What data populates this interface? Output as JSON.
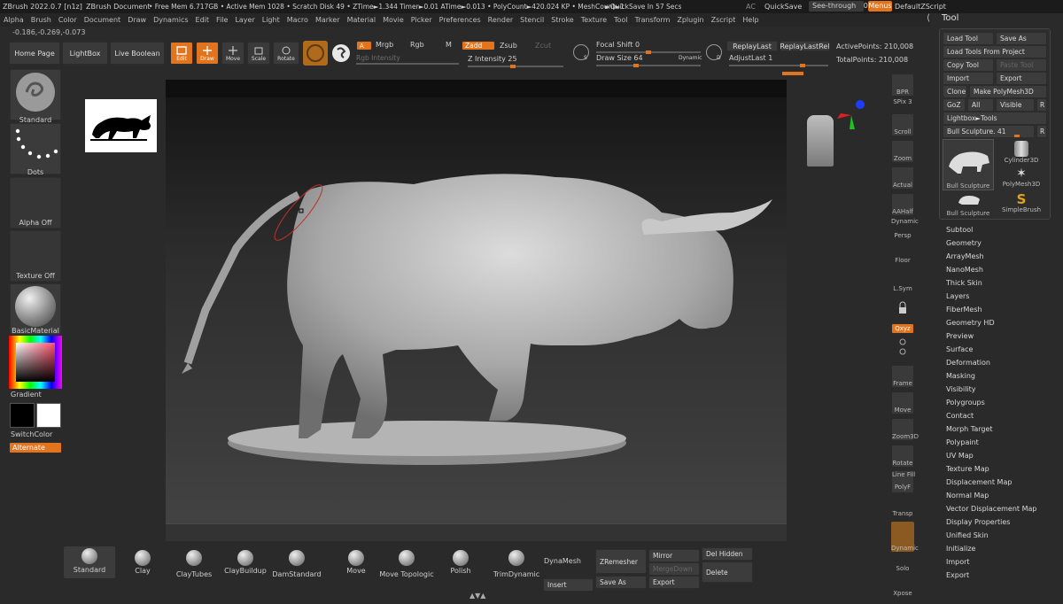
{
  "topbar": {
    "app_title": "ZBrush 2022.0.7 [n1z]",
    "document": "ZBrush Document",
    "stats": "• Free Mem 6.717GB • Active Mem 1028 • Scratch Disk 49 • ZTime►1.344 Timer►0.01 ATime►0.013 • PolyCount►420.024 KP • MeshCount►1",
    "quicksave_timer": "►QuickSave In 57 Secs",
    "ac": "AC",
    "quicksave": "QuickSave",
    "seethrough": "See-through",
    "seethrough_value": "0",
    "menus": "Menus",
    "script": "DefaultZScript"
  },
  "menubar": [
    "Alpha",
    "Brush",
    "Color",
    "Document",
    "Draw",
    "Dynamics",
    "Edit",
    "File",
    "Layer",
    "Light",
    "Macro",
    "Marker",
    "Material",
    "Movie",
    "Picker",
    "Preferences",
    "Render",
    "Stencil",
    "Stroke",
    "Texture",
    "Tool",
    "Transform",
    "Zplugin",
    "Zscript",
    "Help"
  ],
  "coords": "-0.186,-0.269,-0.073",
  "toolbar": {
    "home_page": "Home Page",
    "lightbox": "LightBox",
    "live_boolean": "Live Boolean",
    "edit": "Edit",
    "draw": "Draw",
    "move": "Move",
    "scale": "Scale",
    "rotate": "Rotate",
    "a": "A",
    "mrgb": "Mrgb",
    "rgb": "Rgb",
    "m": "M",
    "rgb_intensity": "Rgb Intensity",
    "zadd": "Zadd",
    "zsub": "Zsub",
    "zcut": "Zcut",
    "z_intensity_label": "Z Intensity",
    "z_intensity": "25",
    "focal_shift_label": "Focal Shift",
    "focal_shift": "0",
    "draw_size_label": "Draw Size",
    "draw_size": "64",
    "dynamic": "Dynamic",
    "replaylast": "ReplayLast",
    "replaylastrel": "ReplayLastRel",
    "adjustlast_label": "AdjustLast",
    "adjustlast": "1",
    "activepoints": "ActivePoints: 210,008",
    "totalpoints": "TotalPoints: 210,008",
    "s": "S",
    "d": "D"
  },
  "leftshelf": {
    "standard": "Standard",
    "dots": "Dots",
    "alpha_off": "Alpha Off",
    "texture_off": "Texture Off",
    "basic_material": "BasicMaterial",
    "gradient": "Gradient",
    "switchcolor": "SwitchColor",
    "alternate": "Alternate"
  },
  "rightshelf": {
    "bpr": "BPR",
    "spix": "SPix 3",
    "scroll": "Scroll",
    "zoom": "Zoom",
    "actual": "Actual",
    "aahalf": "AAHalf",
    "dynamic": "Dynamic",
    "persp": "Persp",
    "floor": "Floor",
    "lsym": "L.Sym",
    "xyz": "Qxyz",
    "frame": "Frame",
    "move": "Move",
    "zoom3d": "Zoom3D",
    "rotate": "Rotate",
    "linefill": "Line Fill",
    "polyf": "PolyF",
    "transp": "Transp",
    "dynamic2": "Dynamic",
    "solo": "Solo",
    "xpose": "Xpose"
  },
  "toolpanel": {
    "title": "Tool",
    "load_tool": "Load Tool",
    "save_as": "Save As",
    "load_from_project": "Load Tools From Project",
    "copy_tool": "Copy Tool",
    "paste_tool": "Paste Tool",
    "import": "Import",
    "export": "Export",
    "clone": "Clone",
    "make_polymesh": "Make PolyMesh3D",
    "goz": "GoZ",
    "all": "All",
    "visible": "Visible",
    "r": "R",
    "lightbox_tools": "Lightbox►Tools",
    "current_tool": "Bull Sculpture.",
    "current_tool_value": "41",
    "thumbs": [
      "Bull Sculpture",
      "Cylinder3D",
      "Bull Sculpture",
      "PolyMesh3D",
      "Bull Sculpture",
      "SimpleBrush"
    ],
    "subpalettes": [
      "Subtool",
      "Geometry",
      "ArrayMesh",
      "NanoMesh",
      "Thick Skin",
      "Layers",
      "FiberMesh",
      "Geometry HD",
      "Preview",
      "Surface",
      "Deformation",
      "Masking",
      "Visibility",
      "Polygroups",
      "Contact",
      "Morph Target",
      "Polypaint",
      "UV Map",
      "Texture Map",
      "Displacement Map",
      "Normal Map",
      "Vector Displacement Map",
      "Display Properties",
      "Unified Skin",
      "Initialize",
      "Import",
      "Export"
    ]
  },
  "bottomshelf": {
    "brushes": [
      "Standard",
      "Clay",
      "ClayTubes",
      "ClayBuildup",
      "DamStandard",
      "Move",
      "Move Topologic",
      "Polish",
      "TrimDynamic"
    ],
    "dynamesh": "DynaMesh",
    "insert": "Insert",
    "zremesher": "ZRemesher",
    "save_as": "Save As",
    "mirror": "Mirror",
    "mergedown": "MergeDown",
    "export": "Export",
    "del_hidden": "Del Hidden",
    "delete": "Delete"
  },
  "colors": {
    "accent": "#e2741d",
    "panel": "#2a2a2a",
    "canvas": "#1e1e1e"
  }
}
